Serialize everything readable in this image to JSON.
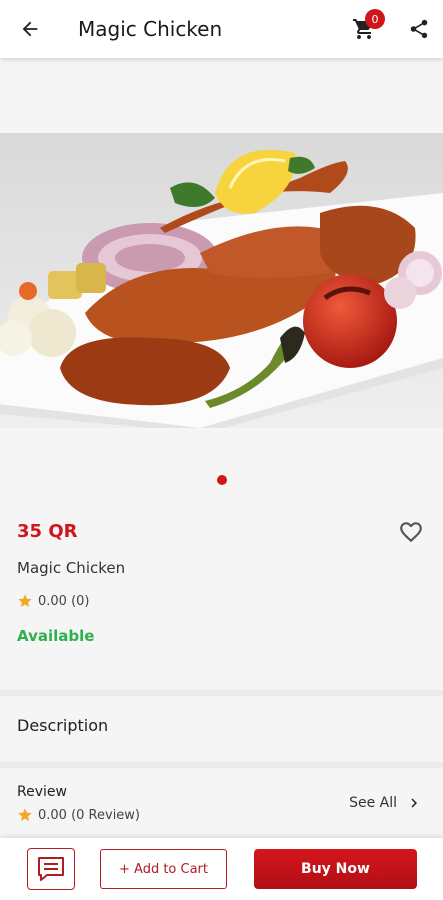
{
  "app_bar": {
    "title": "Magic Chicken",
    "cart_count": "0",
    "icons": [
      "back-arrow-icon",
      "cart-icon",
      "share-icon"
    ]
  },
  "gallery": {
    "image_description_icon": "food-photo",
    "page_count": 1,
    "active_index": 0
  },
  "product": {
    "price": "35 QR",
    "name": "Magic Chicken",
    "rating": "0.00 (0)",
    "availability": "Available"
  },
  "description": {
    "title": "Description"
  },
  "review": {
    "title": "Review",
    "rating": "0.00 (0 Review)",
    "see_all": "See All"
  },
  "bottom_bar": {
    "add_to_cart": "+ Add to Cart",
    "buy_now": "Buy Now"
  },
  "colors": {
    "brand_red": "#d0161b",
    "available_green": "#2db14a",
    "star_orange": "#f5a623"
  }
}
